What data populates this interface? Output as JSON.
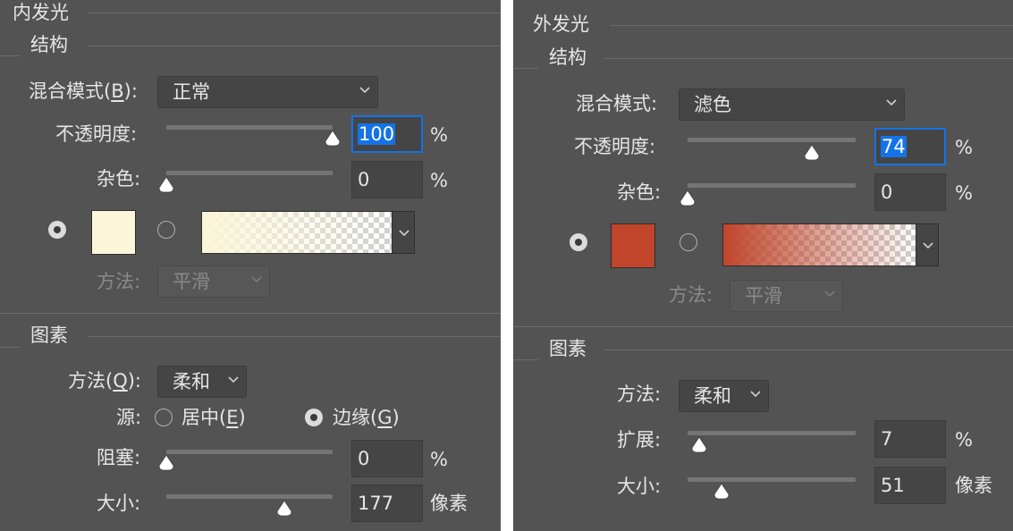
{
  "inner": {
    "title": "内发光",
    "structure": {
      "heading": "结构",
      "blend_label": "混合模式(B):",
      "blend_label_text": "混合模式(",
      "blend_label_key": "B",
      "blend_label_end": "):",
      "blend_value": "正常",
      "opacity_label": "不透明度:",
      "opacity_value": "100",
      "opacity_unit": "%",
      "noise_label": "杂色:",
      "noise_value": "0",
      "noise_unit": "%",
      "color_swatch": "#fbf6d9",
      "gradient_from": "#fbf6d9",
      "method_label": "方法:",
      "method_value": "平滑"
    },
    "elements": {
      "heading": "图素",
      "method_label": "方法(Q):",
      "method_label_text": "方法(",
      "method_label_key": "Q",
      "method_label_end": "):",
      "method_value": "柔和",
      "source_label": "源:",
      "source_center_text": "居中(",
      "source_center_key": "E",
      "source_center_end": ")",
      "source_edge_text": "边缘(",
      "source_edge_key": "G",
      "source_edge_end": ")",
      "source_selected": "边缘",
      "choke_label": "阻塞:",
      "choke_value": "0",
      "choke_unit": "%",
      "size_label": "大小:",
      "size_value": "177",
      "size_unit": "像素"
    },
    "sliders": {
      "opacity": 1.0,
      "noise": 0.0,
      "choke": 0.0,
      "size": 0.708
    }
  },
  "outer": {
    "title": "外发光",
    "structure": {
      "heading": "结构",
      "blend_label": "混合模式:",
      "blend_value": "滤色",
      "opacity_label": "不透明度:",
      "opacity_value": "74",
      "opacity_unit": "%",
      "noise_label": "杂色:",
      "noise_value": "0",
      "noise_unit": "%",
      "color_swatch": "#c0452a",
      "gradient_from": "#c0452a",
      "method_label": "方法:",
      "method_value": "平滑"
    },
    "elements": {
      "heading": "图素",
      "method_label": "方法:",
      "method_value": "柔和",
      "spread_label": "扩展:",
      "spread_value": "7",
      "spread_unit": "%",
      "size_label": "大小:",
      "size_value": "51",
      "size_unit": "像素"
    },
    "sliders": {
      "opacity": 0.74,
      "noise": 0.0,
      "spread": 0.07,
      "size": 0.204
    }
  },
  "colors": {
    "panel_bg": "#535353",
    "field_bg": "#454545",
    "focus": "#1473e6"
  },
  "icons": {
    "chevron": "chevron-down-icon",
    "slider_thumb": "triangle-slider-thumb-icon",
    "radio": "radio-button-icon"
  }
}
